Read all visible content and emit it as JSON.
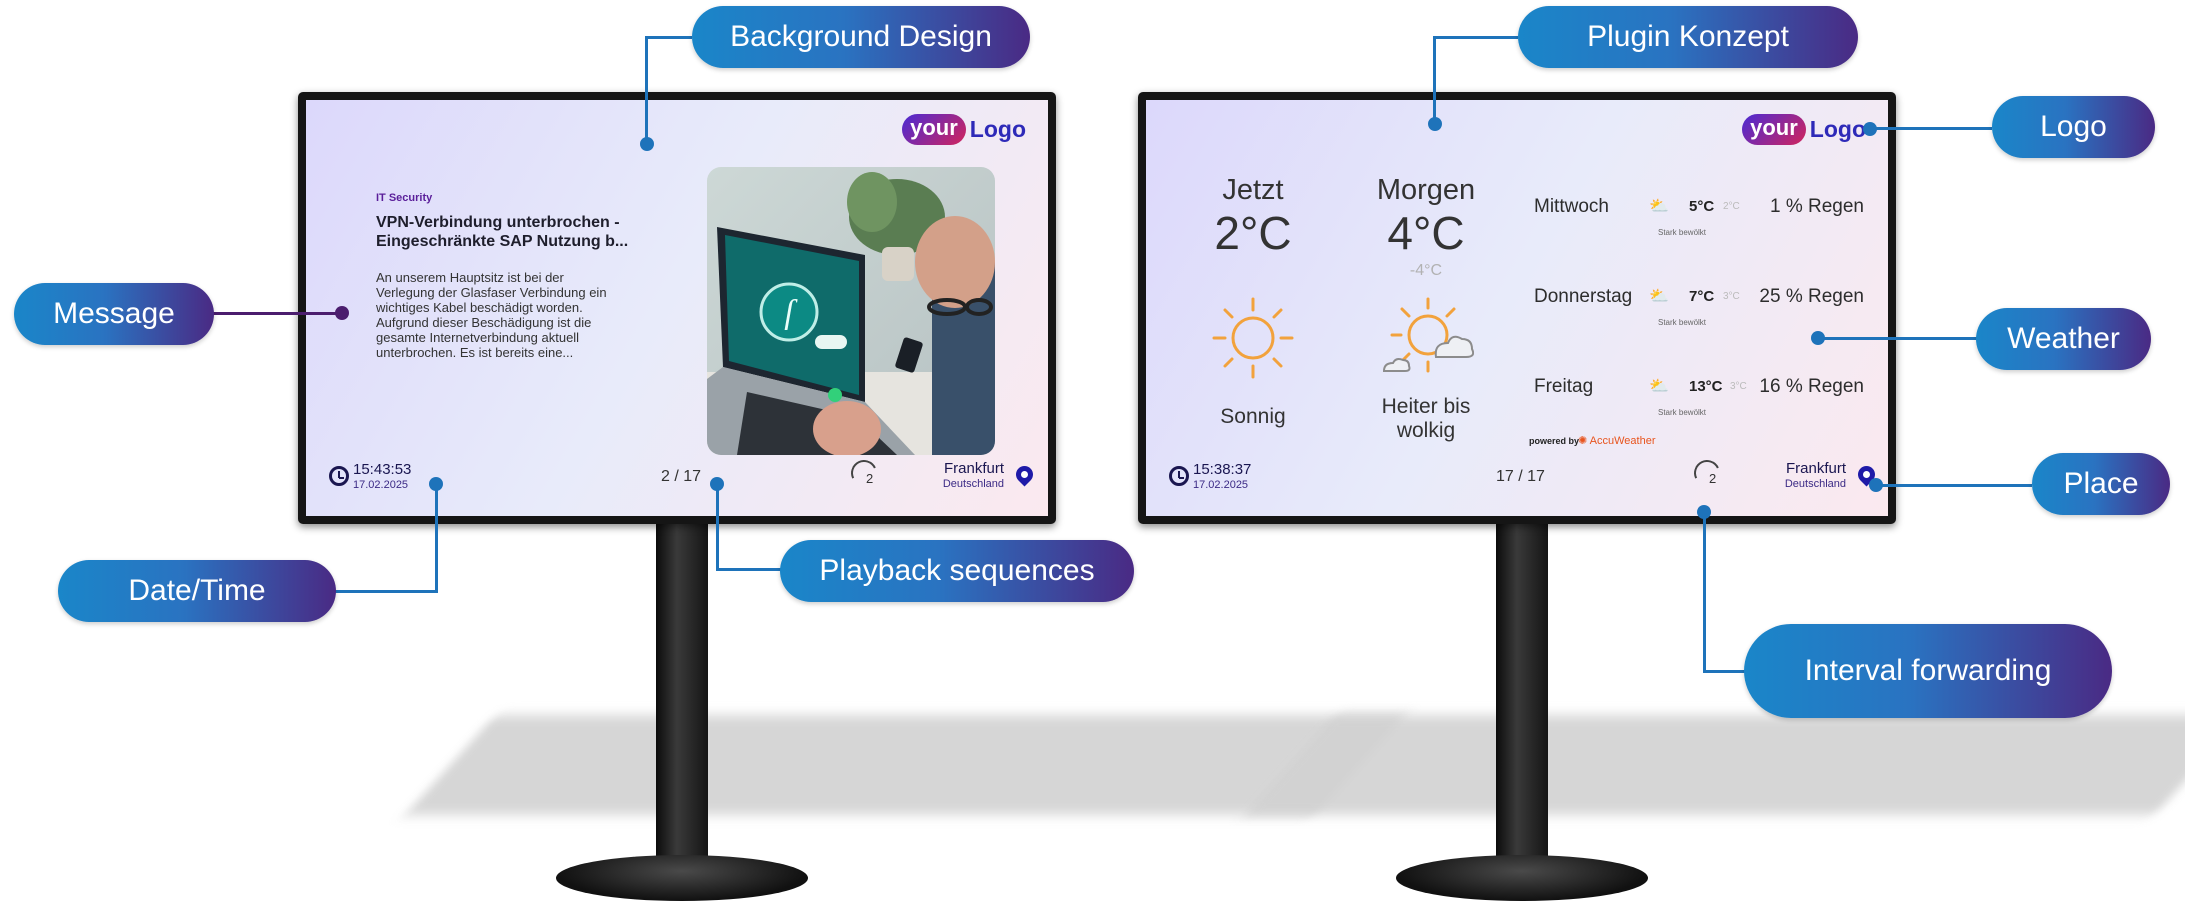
{
  "callouts": {
    "background_design": "Background Design",
    "plugin_konzept": "Plugin Konzept",
    "logo": "Logo",
    "message": "Message",
    "weather": "Weather",
    "place": "Place",
    "date_time": "Date/Time",
    "playback_sequences": "Playback sequences",
    "interval_forwarding": "Interval forwarding"
  },
  "left_screen": {
    "logo_your": "your",
    "logo_logo": "Logo",
    "category": "IT Security",
    "headline_line1": "VPN-Verbindung unterbrochen -",
    "headline_line2": "Eingeschränkte SAP Nutzung b...",
    "body_line1": "An unserem Hauptsitz ist bei der",
    "body_line2": "Verlegung der Glasfaser Verbindung ein",
    "body_line3": "wichtiges Kabel beschädigt worden.",
    "body_line4": "Aufgrund dieser Beschädigung ist die",
    "body_line5": "gesamte Internetverbindung aktuell",
    "body_line6": "unterbrochen. Es ist bereits eine...",
    "time": "15:43:53",
    "date": "17.02.2025",
    "sequence": "2 / 17",
    "interval": "2",
    "city": "Frankfurt",
    "country": "Deutschland"
  },
  "right_screen": {
    "logo_your": "your",
    "logo_logo": "Logo",
    "now_label": "Jetzt",
    "now_temp": "2°C",
    "now_condition": "Sonnig",
    "tomorrow_label": "Morgen",
    "tomorrow_temp": "4°C",
    "tomorrow_low": "-4°C",
    "tomorrow_condition_line1": "Heiter bis",
    "tomorrow_condition_line2": "wolkig",
    "forecast": [
      {
        "day": "Mittwoch",
        "high": "5°C",
        "low": "2°C",
        "desc": "Stark bewölkt",
        "rain": "1 % Regen"
      },
      {
        "day": "Donnerstag",
        "high": "7°C",
        "low": "3°C",
        "desc": "Stark bewölkt",
        "rain": "25 % Regen"
      },
      {
        "day": "Freitag",
        "high": "13°C",
        "low": "3°C",
        "desc": "Stark bewölkt",
        "rain": "16 % Regen"
      }
    ],
    "powered_by": "powered by",
    "provider": "AccuWeather",
    "time": "15:38:37",
    "date": "17.02.2025",
    "sequence": "17 / 17",
    "interval": "2",
    "city": "Frankfurt",
    "country": "Deutschland"
  },
  "colors": {
    "callout_start": "#1a86c9",
    "callout_end": "#4a2a84",
    "connector_blue": "#1e73ba",
    "connector_purple": "#4b1d6e",
    "accent_sun": "#f2a23c"
  }
}
